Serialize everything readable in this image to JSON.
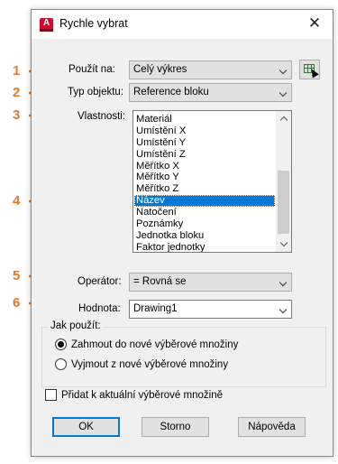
{
  "callouts": [
    "1",
    "2",
    "3",
    "4",
    "5",
    "6"
  ],
  "dialog": {
    "title": "Rychle vybrat",
    "app_icon_letter": "A",
    "close_glyph": "✕"
  },
  "apply_to": {
    "label": "Použít na:",
    "value": "Celý výkres"
  },
  "object_type": {
    "label": "Typ objektu:",
    "value": "Reference bloku"
  },
  "properties": {
    "label": "Vlastnosti:",
    "items": [
      "Materiál",
      "Umístění X",
      "Umístění Y",
      "Umístění Z",
      "Měřítko X",
      "Měřítko Y",
      "Měřítko Z",
      "Název",
      "Natočení",
      "Poznámky",
      "Jednotka bloku",
      "Faktor jednotky"
    ],
    "selected": "Název"
  },
  "operator": {
    "label": "Operátor:",
    "value": "= Rovná se"
  },
  "value": {
    "label": "Hodnota:",
    "value": "Drawing1"
  },
  "how_to_apply": {
    "title": "Jak použít:",
    "include_label": "Zahmout do nové výběrové množiny",
    "exclude_label": "Vyjmout z nové výběrové množiny",
    "selected": "include"
  },
  "append": {
    "label": "Přidat k aktuální výběrové množině",
    "checked": false
  },
  "buttons": {
    "ok": "OK",
    "cancel": "Storno",
    "help": "Nápověda"
  },
  "colors": {
    "accent": "#0078d7",
    "callout": "#e87722",
    "app_icon": "#c8102e"
  }
}
